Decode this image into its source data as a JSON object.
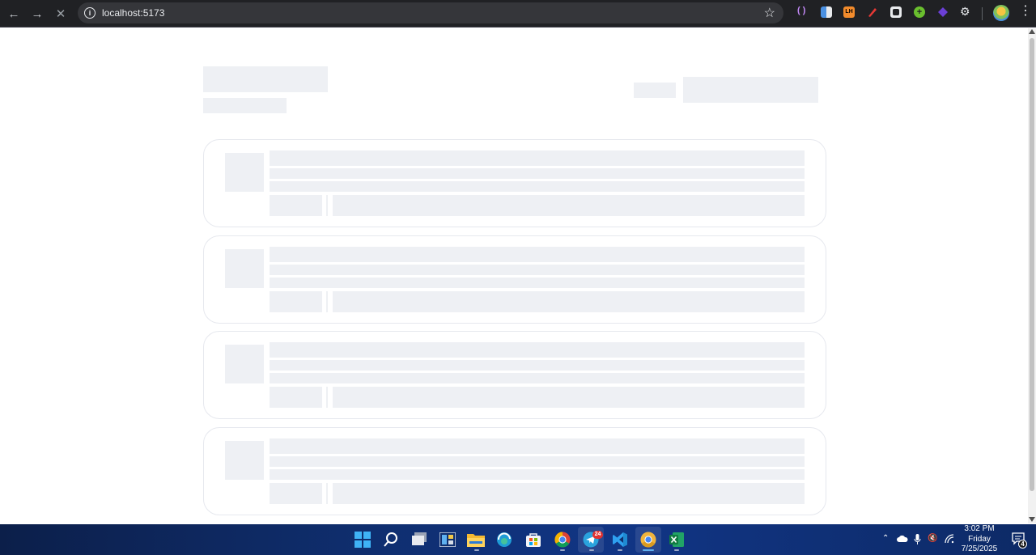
{
  "browser": {
    "url": "localhost:5173",
    "back_icon": "arrow-left-icon",
    "forward_icon": "arrow-right-icon",
    "stop_icon": "close-icon",
    "info_icon": "info-icon",
    "bookmark_icon": "star-icon",
    "menu_icon": "more-vertical-icon",
    "extensions": [
      "bracket-extension-icon",
      "document-extension-icon",
      "lh-extension-icon",
      "pen-extension-icon",
      "square-extension-icon",
      "plus-extension-icon",
      "diamond-extension-icon",
      "puzzle-extension-icon"
    ]
  },
  "page": {
    "state": "loading-skeleton",
    "card_count": 4
  },
  "taskbar": {
    "apps": [
      "windows-start-icon",
      "search-icon",
      "task-view-icon",
      "widgets-icon",
      "file-explorer-icon",
      "edge-icon",
      "store-icon",
      "chrome-icon",
      "telegram-icon",
      "vscode-icon",
      "chrome-canary-icon",
      "excel-icon"
    ],
    "telegram_badge": "24",
    "time": "3:02 PM",
    "day": "Friday",
    "date": "7/25/2025",
    "notifications_count": "4"
  }
}
